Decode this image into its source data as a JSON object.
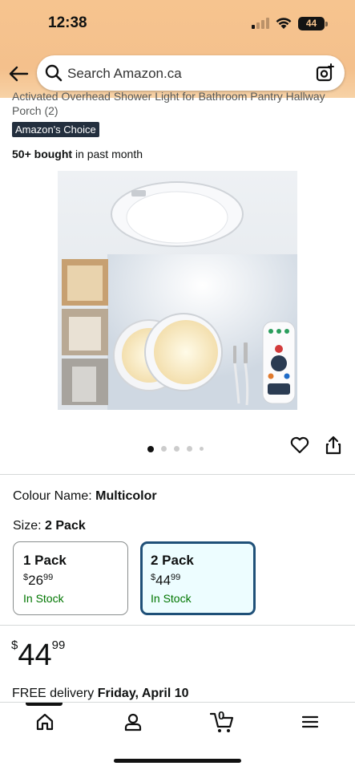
{
  "status_bar": {
    "time": "12:38",
    "battery": "44"
  },
  "search": {
    "placeholder": "Search Amazon.ca"
  },
  "product": {
    "title_partial": "Activated Overhead Shower Light for Bathroom Pantry Hallway",
    "title_line2": "Porch (2)",
    "badge": "Amazon's Choice",
    "bought_bold": "50+ bought",
    "bought_rest": " in past month",
    "image_count": 5,
    "image_index": 1
  },
  "variations": {
    "colour_label": "Colour Name:",
    "colour_value": "Multicolor",
    "size_label": "Size:",
    "size_value": "2 Pack",
    "options": [
      {
        "name": "1 Pack",
        "currency": "$",
        "whole": "26",
        "cents": "99",
        "stock": "In Stock",
        "selected": false
      },
      {
        "name": "2 Pack",
        "currency": "$",
        "whole": "44",
        "cents": "99",
        "stock": "In Stock",
        "selected": true
      }
    ]
  },
  "price": {
    "currency": "$",
    "whole": "44",
    "cents": "99"
  },
  "delivery": {
    "prefix": "FREE delivery ",
    "date": "Friday, April 10"
  },
  "tabbar": {
    "cart_count": "0"
  },
  "colors": {
    "accent": "#1f5078",
    "in_stock": "#007600",
    "badge_bg": "#232f3e",
    "header": "#f6c48f"
  },
  "icons": [
    "back-arrow-icon",
    "search-icon",
    "camera-lens-icon",
    "heart-icon",
    "share-icon",
    "home-icon",
    "account-icon",
    "cart-icon",
    "menu-icon"
  ]
}
